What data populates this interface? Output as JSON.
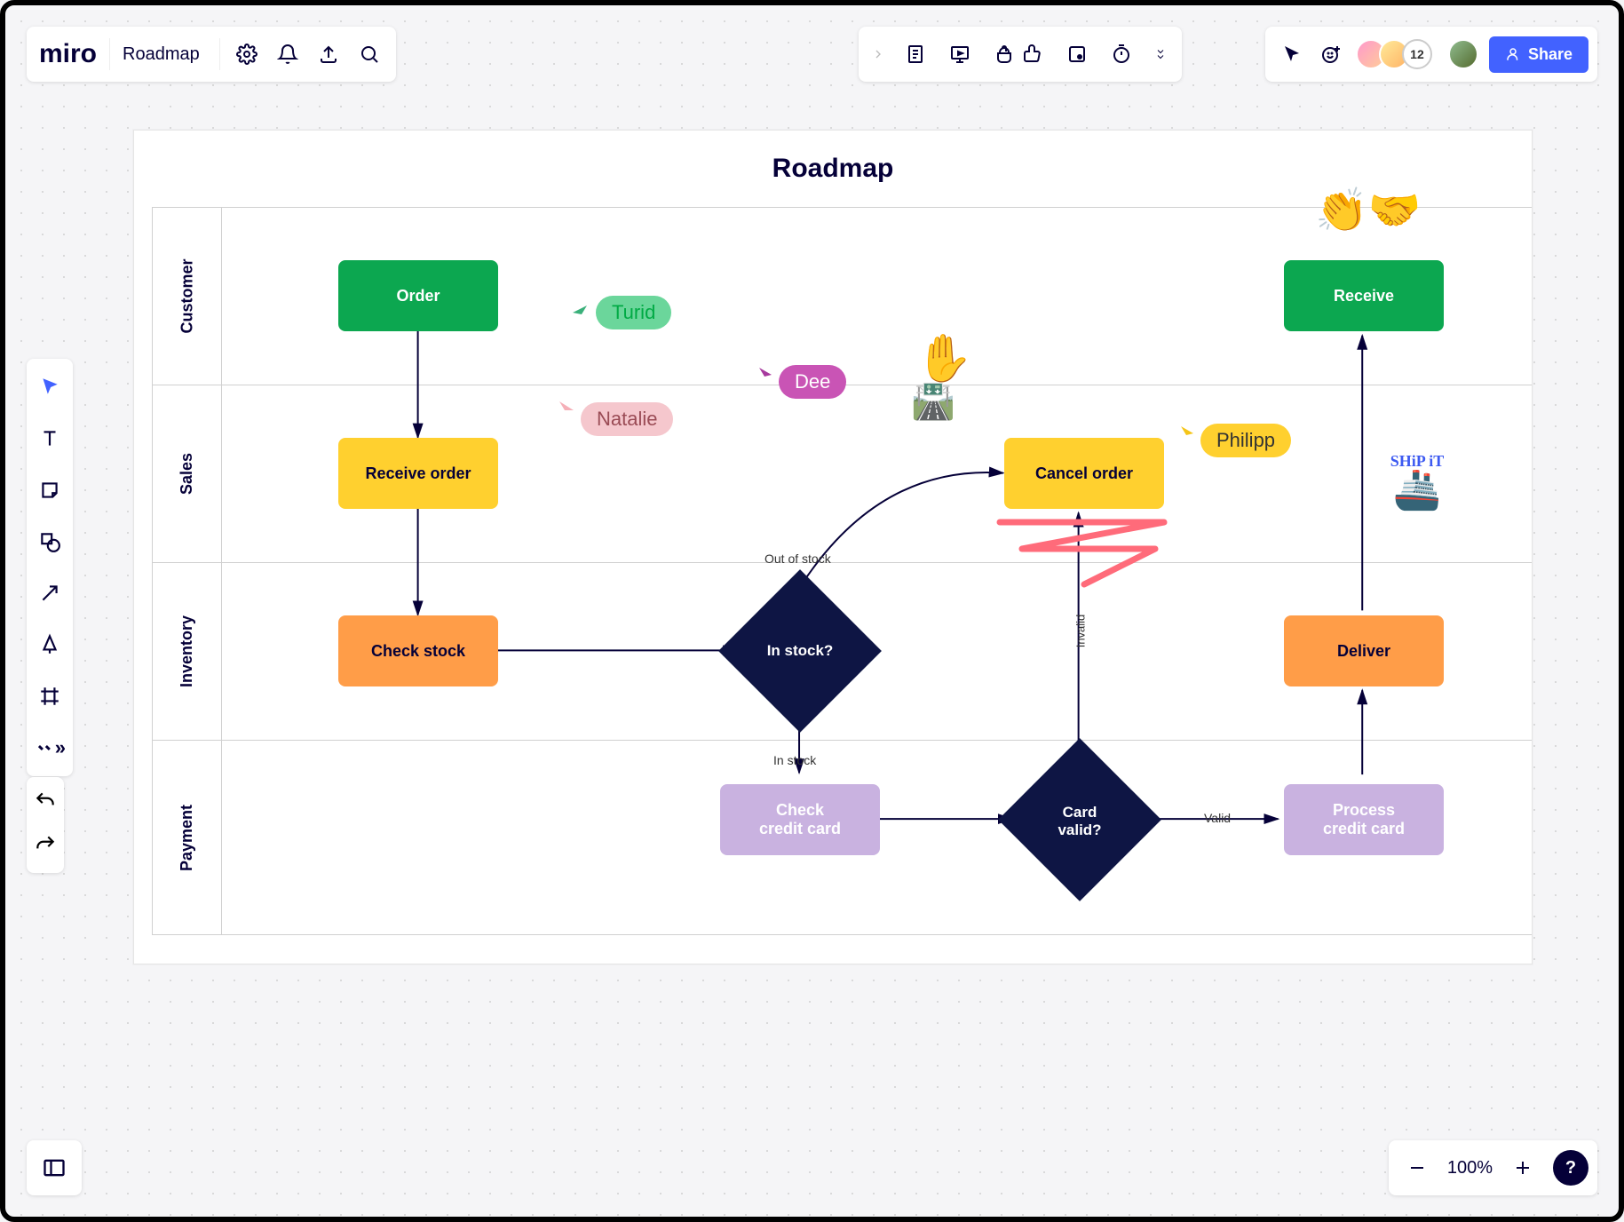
{
  "app": {
    "logo": "miro",
    "board_name": "Roadmap"
  },
  "top_mid": {
    "hidden": true
  },
  "share": {
    "label": "Share",
    "extra_count": "12"
  },
  "zoom": {
    "level": "100%"
  },
  "frame": {
    "title": "Roadmap"
  },
  "lanes": {
    "l1": "Customer",
    "l2": "Sales",
    "l3": "Inventory",
    "l4": "Payment"
  },
  "nodes": {
    "order": "Order",
    "receive": "Receive",
    "receive_order": "Receive order",
    "cancel_order": "Cancel order",
    "check_stock": "Check stock",
    "deliver": "Deliver",
    "in_stock_q": "In stock?",
    "card_valid_q": "Card\nvalid?",
    "check_cc": "Check\ncredit card",
    "process_cc": "Process\ncredit card"
  },
  "edges": {
    "out_of_stock": "Out of stock",
    "in_stock": "In stock",
    "valid": "Valid",
    "invalid": "Invalid"
  },
  "cursors": {
    "turid": "Turid",
    "natalie": "Natalie",
    "dee": "Dee",
    "philipp": "Philipp"
  },
  "stickers": {
    "shipit_line1": "SHiP iT"
  }
}
